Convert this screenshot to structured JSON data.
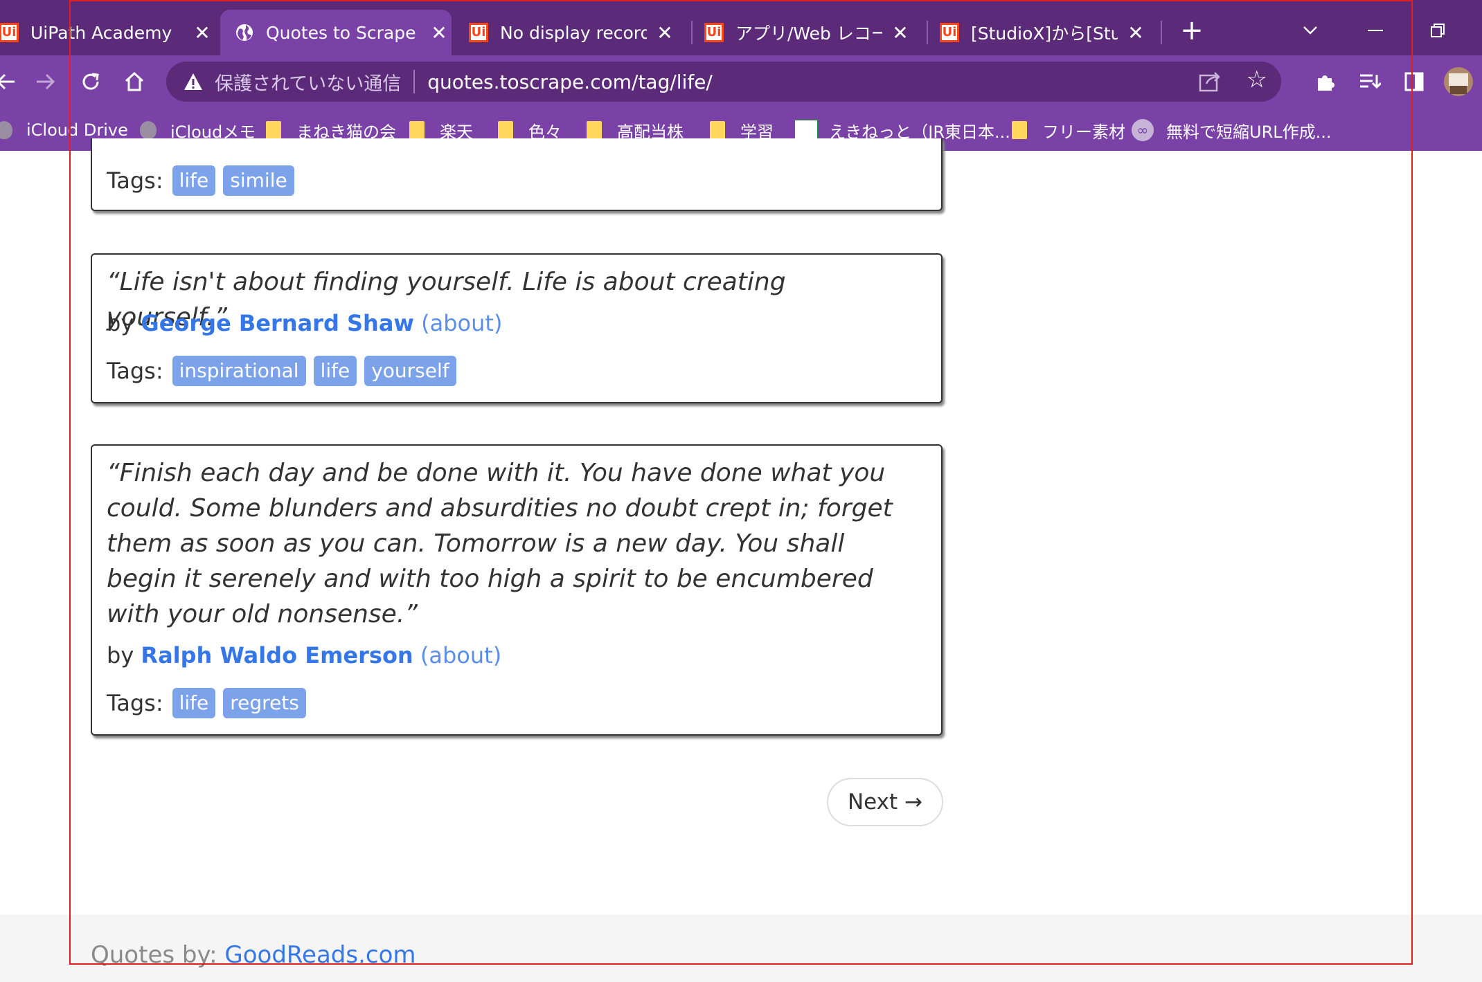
{
  "browser": {
    "tabs": [
      {
        "label": "UiPath Academy",
        "icon": "uipath-icon",
        "active": false
      },
      {
        "label": "Quotes to Scrape",
        "icon": "globe-icon",
        "active": true
      },
      {
        "label": "No display recording",
        "icon": "uipath-icon",
        "active": false
      },
      {
        "label": "アプリ/Web レコーダー",
        "icon": "uipath-icon",
        "active": false
      },
      {
        "label": "[StudioX]から[Studio",
        "icon": "uipath-icon",
        "active": false
      }
    ],
    "tab_close_glyph": "✕",
    "new_tab_glyph": "+",
    "logo_text": "Ui",
    "address": {
      "security_status": "保護されていない通信",
      "url": "quotes.toscrape.com/tag/life/"
    },
    "bookmarks": [
      {
        "label": "iCloud Drive",
        "icon": "apple-icon"
      },
      {
        "label": "iCloudメモ",
        "icon": "apple-icon"
      },
      {
        "label": "まねき猫の会",
        "icon": "folder-icon"
      },
      {
        "label": "楽天",
        "icon": "folder-icon"
      },
      {
        "label": "色々",
        "icon": "folder-icon"
      },
      {
        "label": "高配当株",
        "icon": "folder-icon"
      },
      {
        "label": "学習",
        "icon": "folder-icon"
      },
      {
        "label": "えきねっと（JR東日本...",
        "icon": "ekinet-icon"
      },
      {
        "label": "フリー素材",
        "icon": "folder-icon"
      },
      {
        "label": "無料で短縮URL作成...",
        "icon": "infinity-icon"
      }
    ]
  },
  "page": {
    "quotes": [
      {
        "text": "",
        "by": "",
        "author": "",
        "about": "",
        "tags_label": "Tags:",
        "tags": [
          "life",
          "simile"
        ]
      },
      {
        "text": "“Life isn't about finding yourself. Life is about creating yourself.”",
        "by": "by",
        "author": "George Bernard Shaw",
        "about": "(about)",
        "tags_label": "Tags:",
        "tags": [
          "inspirational",
          "life",
          "yourself"
        ]
      },
      {
        "text": "“Finish each day and be done with it. You have done what you could. Some blunders and absurdities no doubt crept in; forget them as soon as you can. Tomorrow is a new day. You shall begin it serenely and with too high a spirit to be encumbered with your old nonsense.”",
        "by": "by",
        "author": "Ralph Waldo Emerson",
        "about": "(about)",
        "tags_label": "Tags:",
        "tags": [
          "life",
          "regrets"
        ]
      }
    ],
    "next_label": "Next →",
    "footer": {
      "prefix": "Quotes by:",
      "link": "GoodReads.com"
    }
  },
  "colors": {
    "tab_bar": "#5b2b79",
    "toolbar": "#7a41a6",
    "tag_bg": "#7ca3ea",
    "link": "#3677e8",
    "annotation_frame": "#e02020"
  }
}
